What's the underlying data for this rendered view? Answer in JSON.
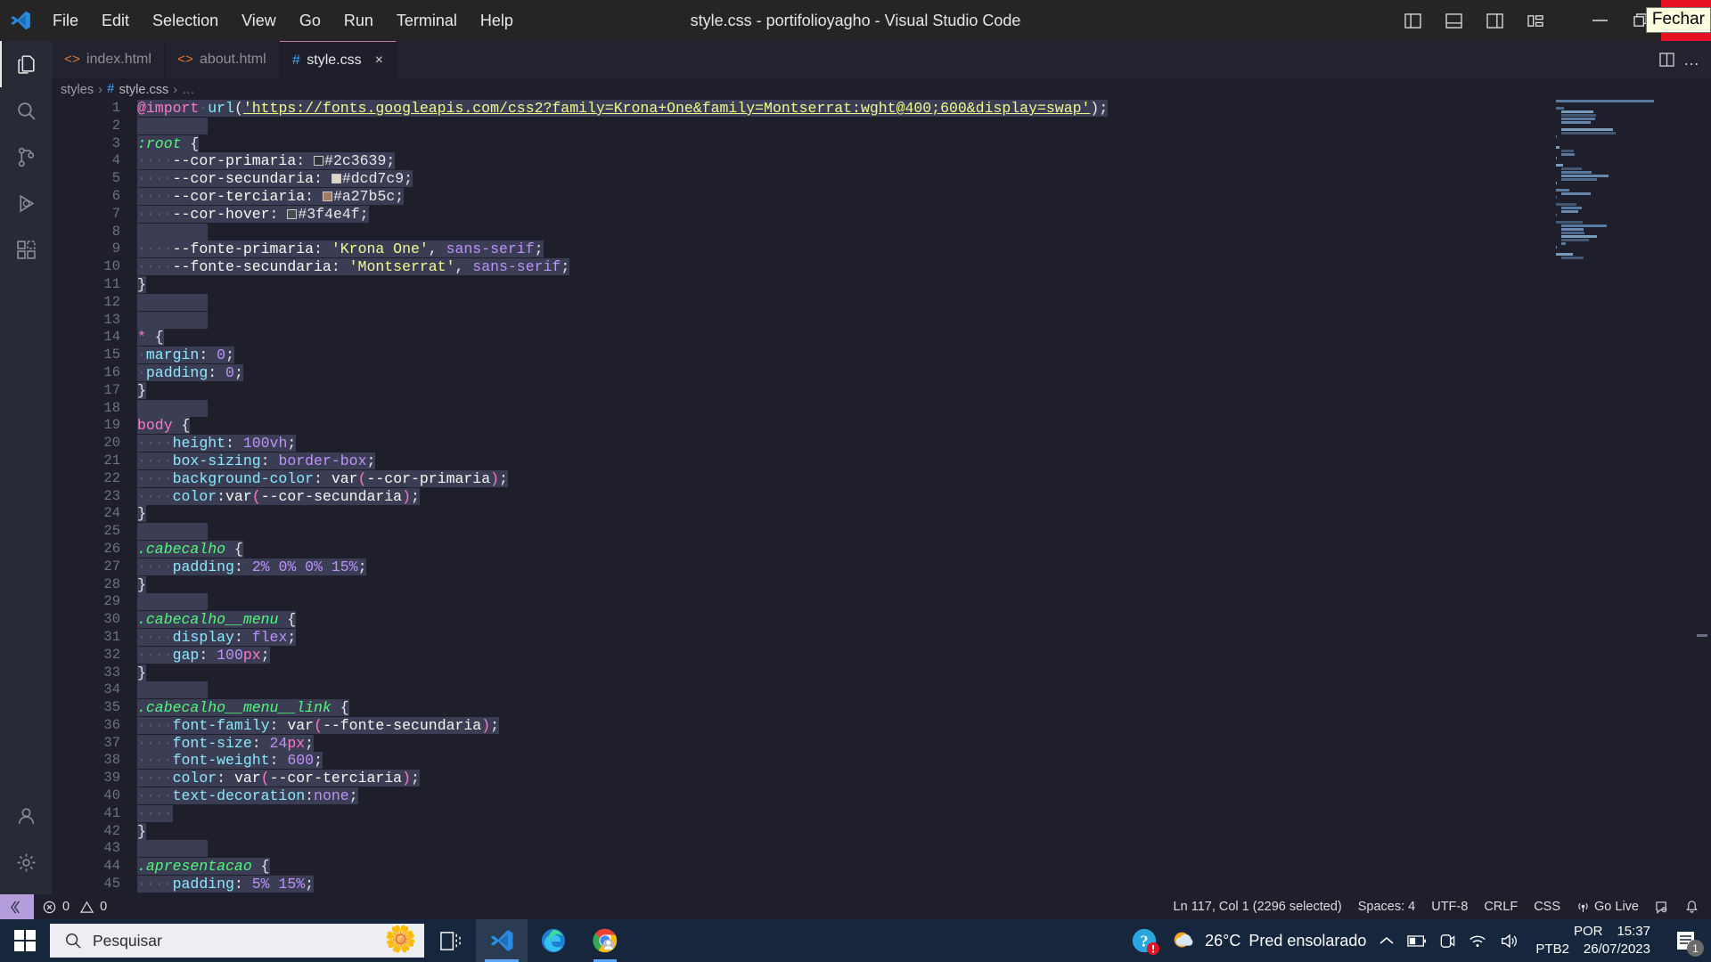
{
  "window": {
    "title": "style.css - portifolioyagho - Visual Studio Code",
    "menu": [
      "File",
      "Edit",
      "Selection",
      "View",
      "Go",
      "Run",
      "Terminal",
      "Help"
    ],
    "tooltip": "Fechar",
    "layout_icons": [
      "toggle-primary-sidebar-icon",
      "toggle-panel-icon",
      "toggle-secondary-sidebar-icon",
      "customize-layout-icon"
    ],
    "controls": [
      "minimize-button",
      "restore-button",
      "close-button"
    ]
  },
  "activitybar": {
    "items": [
      {
        "name": "explorer",
        "icon": "files-icon",
        "active": true
      },
      {
        "name": "search",
        "icon": "search-icon",
        "active": false
      },
      {
        "name": "source-control",
        "icon": "source-control-icon",
        "active": false
      },
      {
        "name": "run-and-debug",
        "icon": "debug-icon",
        "active": false
      },
      {
        "name": "extensions",
        "icon": "extensions-icon",
        "active": false
      }
    ],
    "bottom": [
      {
        "name": "accounts",
        "icon": "account-icon"
      },
      {
        "name": "manage",
        "icon": "gear-icon"
      }
    ]
  },
  "tabs": [
    {
      "label": "index.html",
      "icon": "html-icon",
      "active": false,
      "closable": false
    },
    {
      "label": "about.html",
      "icon": "html-icon",
      "active": false,
      "closable": false
    },
    {
      "label": "style.css",
      "icon": "css-icon",
      "active": true,
      "closable": true,
      "close_label": "×"
    }
  ],
  "tabbar_actions": [
    {
      "name": "split-editor-icon",
      "glyph": "◫"
    },
    {
      "name": "more-actions-icon",
      "glyph": "…"
    }
  ],
  "breadcrumb": {
    "folder": "styles",
    "separator": "›",
    "hash": "#",
    "file": "style.css",
    "ellipsis": "…"
  },
  "editor": {
    "selection_active": true,
    "lines": [
      {
        "n": 1,
        "tokens": [
          {
            "t": "@import",
            "c": "c-at"
          },
          {
            "t": " ",
            "c": "c-dot"
          },
          {
            "t": "url",
            "c": "c-fn"
          },
          {
            "t": "(",
            "c": "c-punct"
          },
          {
            "t": "'https://fonts.googleapis.com/css2?family=Krona+One&family=Montserrat:wght@400;600&display=swap'",
            "c": "c-str"
          },
          {
            "t": ")",
            "c": "c-punct"
          },
          {
            "t": ";",
            "c": "c-punct"
          }
        ]
      },
      {
        "n": 2,
        "tokens": []
      },
      {
        "n": 3,
        "tokens": [
          {
            "t": ":root",
            "c": "c-sel"
          },
          {
            "t": " {",
            "c": "c-punct"
          }
        ]
      },
      {
        "n": 4,
        "tokens": [
          {
            "t": "    ",
            "c": "c-dot"
          },
          {
            "t": "--cor-primaria",
            "c": "c-white"
          },
          {
            "t": ": ",
            "c": "c-punct"
          },
          {
            "t": "█",
            "c": "swatch",
            "color": "#2c3639"
          },
          {
            "t": "#2c3639",
            "c": "c-hex"
          },
          {
            "t": ";",
            "c": "c-punct"
          }
        ]
      },
      {
        "n": 5,
        "tokens": [
          {
            "t": "    ",
            "c": "c-dot"
          },
          {
            "t": "--cor-secundaria",
            "c": "c-white"
          },
          {
            "t": ": ",
            "c": "c-punct"
          },
          {
            "t": "█",
            "c": "swatch",
            "color": "#dcd7c9"
          },
          {
            "t": "#dcd7c9",
            "c": "c-hex"
          },
          {
            "t": ";",
            "c": "c-punct"
          }
        ]
      },
      {
        "n": 6,
        "tokens": [
          {
            "t": "    ",
            "c": "c-dot"
          },
          {
            "t": "--cor-terciaria",
            "c": "c-white"
          },
          {
            "t": ": ",
            "c": "c-punct"
          },
          {
            "t": "█",
            "c": "swatch",
            "color": "#a27b5c"
          },
          {
            "t": "#a27b5c",
            "c": "c-hex"
          },
          {
            "t": ";",
            "c": "c-punct"
          }
        ]
      },
      {
        "n": 7,
        "tokens": [
          {
            "t": "    ",
            "c": "c-dot"
          },
          {
            "t": "--cor-hover",
            "c": "c-white"
          },
          {
            "t": ": ",
            "c": "c-punct"
          },
          {
            "t": "█",
            "c": "swatch",
            "color": "#3f4e4f"
          },
          {
            "t": "#3f4e4f",
            "c": "c-hex"
          },
          {
            "t": ";",
            "c": "c-punct"
          }
        ]
      },
      {
        "n": 8,
        "tokens": []
      },
      {
        "n": 9,
        "tokens": [
          {
            "t": "    ",
            "c": "c-dot"
          },
          {
            "t": "--fonte-primaria",
            "c": "c-white"
          },
          {
            "t": ": ",
            "c": "c-punct"
          },
          {
            "t": "'Krona One'",
            "c": "c-str2"
          },
          {
            "t": ", ",
            "c": "c-punct"
          },
          {
            "t": "sans-serif",
            "c": "c-var"
          },
          {
            "t": ";",
            "c": "c-punct"
          }
        ]
      },
      {
        "n": 10,
        "tokens": [
          {
            "t": "    ",
            "c": "c-dot"
          },
          {
            "t": "--fonte-secundaria",
            "c": "c-white"
          },
          {
            "t": ": ",
            "c": "c-punct"
          },
          {
            "t": "'Montserrat'",
            "c": "c-str2"
          },
          {
            "t": ", ",
            "c": "c-punct"
          },
          {
            "t": "sans-serif",
            "c": "c-var"
          },
          {
            "t": ";",
            "c": "c-punct"
          }
        ]
      },
      {
        "n": 11,
        "tokens": [
          {
            "t": "}",
            "c": "c-punct"
          }
        ]
      },
      {
        "n": 12,
        "tokens": []
      },
      {
        "n": 13,
        "tokens": []
      },
      {
        "n": 14,
        "tokens": [
          {
            "t": "*",
            "c": "c-tag"
          },
          {
            "t": " {",
            "c": "c-punct"
          }
        ]
      },
      {
        "n": 15,
        "tokens": [
          {
            "t": " ",
            "c": "c-dot"
          },
          {
            "t": "margin",
            "c": "c-prop"
          },
          {
            "t": ": ",
            "c": "c-punct"
          },
          {
            "t": "0",
            "c": "c-num"
          },
          {
            "t": ";",
            "c": "c-punct"
          }
        ]
      },
      {
        "n": 16,
        "tokens": [
          {
            "t": " ",
            "c": "c-dot"
          },
          {
            "t": "padding",
            "c": "c-prop"
          },
          {
            "t": ": ",
            "c": "c-punct"
          },
          {
            "t": "0",
            "c": "c-num"
          },
          {
            "t": ";",
            "c": "c-punct"
          }
        ]
      },
      {
        "n": 17,
        "tokens": [
          {
            "t": "}",
            "c": "c-punct"
          }
        ]
      },
      {
        "n": 18,
        "tokens": []
      },
      {
        "n": 19,
        "tokens": [
          {
            "t": "body",
            "c": "c-tag"
          },
          {
            "t": " {",
            "c": "c-punct"
          }
        ]
      },
      {
        "n": 20,
        "tokens": [
          {
            "t": "    ",
            "c": "c-dot"
          },
          {
            "t": "height",
            "c": "c-prop"
          },
          {
            "t": ": ",
            "c": "c-punct"
          },
          {
            "t": "100vh",
            "c": "c-num"
          },
          {
            "t": ";",
            "c": "c-punct"
          }
        ]
      },
      {
        "n": 21,
        "tokens": [
          {
            "t": "    ",
            "c": "c-dot"
          },
          {
            "t": "box-sizing",
            "c": "c-prop"
          },
          {
            "t": ": ",
            "c": "c-punct"
          },
          {
            "t": "border-box",
            "c": "c-var"
          },
          {
            "t": ";",
            "c": "c-punct"
          }
        ]
      },
      {
        "n": 22,
        "tokens": [
          {
            "t": "    ",
            "c": "c-dot"
          },
          {
            "t": "background-color",
            "c": "c-prop"
          },
          {
            "t": ": ",
            "c": "c-punct"
          },
          {
            "t": "var",
            "c": "c-white"
          },
          {
            "t": "(",
            "c": "c-tag"
          },
          {
            "t": "--cor-primaria",
            "c": "c-white"
          },
          {
            "t": ")",
            "c": "c-tag"
          },
          {
            "t": ";",
            "c": "c-punct"
          }
        ]
      },
      {
        "n": 23,
        "tokens": [
          {
            "t": "    ",
            "c": "c-dot"
          },
          {
            "t": "color",
            "c": "c-prop"
          },
          {
            "t": ":",
            "c": "c-punct"
          },
          {
            "t": "var",
            "c": "c-white"
          },
          {
            "t": "(",
            "c": "c-tag"
          },
          {
            "t": "--cor-secundaria",
            "c": "c-white"
          },
          {
            "t": ")",
            "c": "c-tag"
          },
          {
            "t": ";",
            "c": "c-punct"
          }
        ]
      },
      {
        "n": 24,
        "tokens": [
          {
            "t": "}",
            "c": "c-punct"
          }
        ]
      },
      {
        "n": 25,
        "tokens": []
      },
      {
        "n": 26,
        "tokens": [
          {
            "t": ".cabecalho",
            "c": "c-sel"
          },
          {
            "t": " {",
            "c": "c-punct"
          }
        ]
      },
      {
        "n": 27,
        "tokens": [
          {
            "t": "    ",
            "c": "c-dot"
          },
          {
            "t": "padding",
            "c": "c-prop"
          },
          {
            "t": ": ",
            "c": "c-punct"
          },
          {
            "t": "2% 0% 0% 15%",
            "c": "c-num"
          },
          {
            "t": ";",
            "c": "c-punct"
          }
        ]
      },
      {
        "n": 28,
        "tokens": [
          {
            "t": "}",
            "c": "c-punct"
          }
        ]
      },
      {
        "n": 29,
        "tokens": []
      },
      {
        "n": 30,
        "tokens": [
          {
            "t": ".cabecalho__menu",
            "c": "c-sel"
          },
          {
            "t": " {",
            "c": "c-punct"
          }
        ]
      },
      {
        "n": 31,
        "tokens": [
          {
            "t": "    ",
            "c": "c-dot"
          },
          {
            "t": "display",
            "c": "c-prop"
          },
          {
            "t": ": ",
            "c": "c-punct"
          },
          {
            "t": "flex",
            "c": "c-var"
          },
          {
            "t": ";",
            "c": "c-punct"
          }
        ]
      },
      {
        "n": 32,
        "tokens": [
          {
            "t": "    ",
            "c": "c-dot"
          },
          {
            "t": "gap",
            "c": "c-prop"
          },
          {
            "t": ": ",
            "c": "c-punct"
          },
          {
            "t": "100",
            "c": "c-num"
          },
          {
            "t": "px",
            "c": "c-tag"
          },
          {
            "t": ";",
            "c": "c-punct"
          }
        ]
      },
      {
        "n": 33,
        "tokens": [
          {
            "t": "}",
            "c": "c-punct"
          }
        ]
      },
      {
        "n": 34,
        "tokens": []
      },
      {
        "n": 35,
        "tokens": [
          {
            "t": ".cabecalho__menu__link",
            "c": "c-sel"
          },
          {
            "t": " {",
            "c": "c-punct"
          }
        ]
      },
      {
        "n": 36,
        "tokens": [
          {
            "t": "    ",
            "c": "c-dot"
          },
          {
            "t": "font-family",
            "c": "c-prop"
          },
          {
            "t": ": ",
            "c": "c-punct"
          },
          {
            "t": "var",
            "c": "c-white"
          },
          {
            "t": "(",
            "c": "c-tag"
          },
          {
            "t": "--fonte-secundaria",
            "c": "c-white"
          },
          {
            "t": ")",
            "c": "c-tag"
          },
          {
            "t": ";",
            "c": "c-punct"
          }
        ]
      },
      {
        "n": 37,
        "tokens": [
          {
            "t": "    ",
            "c": "c-dot"
          },
          {
            "t": "font-size",
            "c": "c-prop"
          },
          {
            "t": ": ",
            "c": "c-punct"
          },
          {
            "t": "24",
            "c": "c-num"
          },
          {
            "t": "px",
            "c": "c-tag"
          },
          {
            "t": ";",
            "c": "c-punct"
          }
        ]
      },
      {
        "n": 38,
        "tokens": [
          {
            "t": "    ",
            "c": "c-dot"
          },
          {
            "t": "font-weight",
            "c": "c-prop"
          },
          {
            "t": ": ",
            "c": "c-punct"
          },
          {
            "t": "600",
            "c": "c-num"
          },
          {
            "t": ";",
            "c": "c-punct"
          }
        ]
      },
      {
        "n": 39,
        "tokens": [
          {
            "t": "    ",
            "c": "c-dot"
          },
          {
            "t": "color",
            "c": "c-prop"
          },
          {
            "t": ": ",
            "c": "c-punct"
          },
          {
            "t": "var",
            "c": "c-white"
          },
          {
            "t": "(",
            "c": "c-tag"
          },
          {
            "t": "--cor-terciaria",
            "c": "c-white"
          },
          {
            "t": ")",
            "c": "c-tag"
          },
          {
            "t": ";",
            "c": "c-punct"
          }
        ]
      },
      {
        "n": 40,
        "tokens": [
          {
            "t": "    ",
            "c": "c-dot"
          },
          {
            "t": "text-decoration",
            "c": "c-prop"
          },
          {
            "t": ":",
            "c": "c-punct"
          },
          {
            "t": "none",
            "c": "c-var"
          },
          {
            "t": ";",
            "c": "c-punct"
          }
        ]
      },
      {
        "n": 41,
        "tokens": [
          {
            "t": "    ",
            "c": "c-dot"
          }
        ]
      },
      {
        "n": 42,
        "tokens": [
          {
            "t": "}",
            "c": "c-punct"
          }
        ]
      },
      {
        "n": 43,
        "tokens": []
      },
      {
        "n": 44,
        "tokens": [
          {
            "t": ".apresentacao",
            "c": "c-sel"
          },
          {
            "t": " {",
            "c": "c-punct"
          }
        ]
      },
      {
        "n": 45,
        "tokens": [
          {
            "t": "    ",
            "c": "c-dot"
          },
          {
            "t": "padding",
            "c": "c-prop"
          },
          {
            "t": ": ",
            "c": "c-punct"
          },
          {
            "t": "5% 15%",
            "c": "c-num"
          },
          {
            "t": ";",
            "c": "c-punct"
          }
        ]
      }
    ]
  },
  "statusbar": {
    "remote_icon": "remote-window-icon",
    "errors": "0",
    "warnings": "0",
    "error_icon": "error-circle-icon",
    "warning_icon": "warning-triangle-icon",
    "cursor": "Ln 117, Col 1 (2296 selected)",
    "indentation": "Spaces: 4",
    "encoding": "UTF-8",
    "eol": "CRLF",
    "language": "CSS",
    "golive": "Go Live",
    "golive_icon": "broadcast-icon",
    "feedback_icon": "feedback-smiley-icon",
    "bell_icon": "bell-icon"
  },
  "taskbar": {
    "start_icon": "windows-start-icon",
    "search_placeholder": "Pesquisar",
    "search_icon": "search-icon",
    "decoration_icon": "flowers-icon",
    "apps": [
      {
        "name": "task-view-icon",
        "state": "idle"
      },
      {
        "name": "vscode-icon",
        "state": "active"
      },
      {
        "name": "edge-icon",
        "state": "idle"
      },
      {
        "name": "chrome-icon",
        "state": "running"
      }
    ],
    "tray": {
      "help_icon": "help-question-icon",
      "weather_icon": "weather-sun-cloud-icon",
      "temperature": "26°C",
      "condition": "Pred ensolarado",
      "chevron_icon": "chevron-up-icon",
      "icons": [
        "battery-icon",
        "meet-now-icon",
        "network-icon",
        "volume-icon"
      ],
      "language": "POR",
      "keyboard": "PTB2",
      "time": "15:37",
      "date": "26/07/2023",
      "notification_icon": "notification-icon",
      "notification_count": "1"
    }
  },
  "colors": {
    "accent": "#c678a9",
    "close_red": "#e81123",
    "taskbar_bg": "#15263d",
    "editor_bg": "#1e1f2b",
    "selection": "#3a3d54"
  }
}
